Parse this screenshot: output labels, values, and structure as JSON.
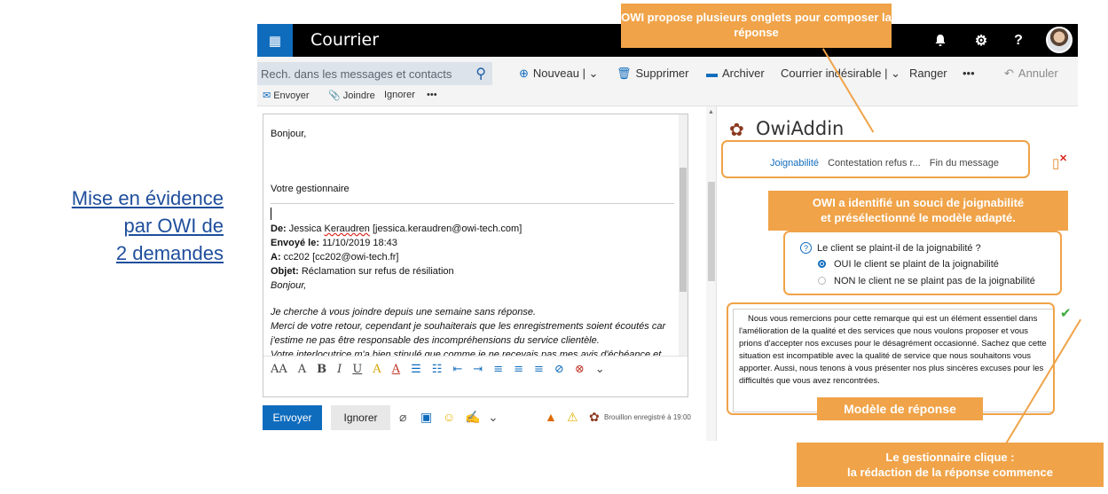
{
  "caption": {
    "line1": "Mise en évidence",
    "line2": "par OWI de",
    "line3": "2 demandes"
  },
  "topbar": {
    "app_title": "Courrier",
    "waffle_icon": "waffle-icon",
    "bell_icon": "bell-icon",
    "gear_icon": "gear-icon",
    "help_label": "?"
  },
  "search": {
    "placeholder": "Rech. dans les messages et contacts"
  },
  "commands": {
    "new_label": "Nouveau",
    "delete_label": "Supprimer",
    "archive_label": "Archiver",
    "junk_label": "Courrier indésirable",
    "sweep_label": "Ranger",
    "more_label": "•••",
    "undo_label": "Annuler"
  },
  "compose_commands": {
    "send_label": "Envoyer",
    "attach_label": "Joindre",
    "discard_label": "Ignorer",
    "more_label": "•••"
  },
  "message": {
    "greeting": "Bonjour,",
    "signature": "Votre gestionnaire",
    "from_label": "De:",
    "from_name": "Jessica",
    "from_surname": "Keraudren",
    "from_email": "[jessica.keraudren@owi-tech.com]",
    "sent_label": "Envoyé le:",
    "sent_value": "11/10/2019 18:43",
    "to_label": "A:",
    "to_value": "cc202 [cc202@owi-tech.fr]",
    "subject_label": "Objet:",
    "subject_value": "Réclamation sur refus de résiliation",
    "quoted_greeting": "Bonjour,",
    "quoted_line1": "Je cherche à vous joindre depuis une semaine sans réponse.",
    "quoted_line2": "Merci de votre retour, cependant je souhaiterais que les enregistrements soient écoutés car",
    "quoted_line3": "j'estime ne pas être responsable des incompréhensions du service clientèle.",
    "quoted_line4": "Votre interlocutrice m'a bien stipulé que comme je ne recevais pas mes avis d'échéance et que"
  },
  "format_bar": {
    "items": [
      "AA",
      "A",
      "B",
      "I",
      "U",
      "A",
      "A",
      "☰",
      "☷",
      "⇤",
      "⇥",
      "≡",
      "≡",
      "≡",
      "⊘",
      "⊗",
      "⌄"
    ]
  },
  "sendbar": {
    "send_label": "Envoyer",
    "discard_label": "Ignorer",
    "draft_status": "Brouillon enregistré à 19:00"
  },
  "addin": {
    "title": "OwiAddin",
    "tabs": [
      "Joignabilité",
      "Contestation refus r...",
      "Fin du message"
    ],
    "question": "Le client se plaint-il de la joignabilité ?",
    "option_yes": "OUI le client se plaint de la joignabilité",
    "option_no": "NON le client ne se plaint pas de la joignabilité",
    "template_text": "Nous vous remercions pour cette remarque qui est un élément essentiel dans l'amélioration de la qualité et des services que nous voulons proposer et vous prions d'accepter nos excuses pour le désagrément occasionné. Sachez que cette situation est incompatible avec la qualité de service que nous souhaitons vous apporter. Aussi, nous tenons à vous présenter nos plus sincères excuses pour les difficultés que vous avez rencontrées."
  },
  "annotations": {
    "tabs_note": "OWI propose plusieurs onglets pour composer la réponse",
    "detect_note_line1": "OWI a identifié un souci de joignabilité",
    "detect_note_line2": "et présélectionné le modèle adapté.",
    "template_note": "Modèle de réponse",
    "click_note_line1": "Le gestionnaire clique :",
    "click_note_line2": "la rédaction de la réponse commence"
  },
  "colors": {
    "accent": "#0f6cbd",
    "annotation": "#f0a348",
    "caption": "#1f4e9c"
  }
}
